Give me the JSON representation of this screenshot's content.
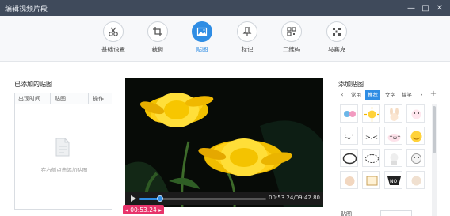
{
  "window": {
    "title": "编辑视频片段",
    "controls": {
      "minimize": "—",
      "maximize": "□",
      "close": "✕"
    }
  },
  "toolbar": {
    "items": [
      {
        "label": "基础设置",
        "icon": "scissors-icon",
        "active": false
      },
      {
        "label": "裁剪",
        "icon": "crop-icon",
        "active": false
      },
      {
        "label": "贴图",
        "icon": "image-icon",
        "active": true
      },
      {
        "label": "标记",
        "icon": "pin-icon",
        "active": false
      },
      {
        "label": "二维码",
        "icon": "qrcode-icon",
        "active": false
      },
      {
        "label": "马赛克",
        "icon": "mosaic-icon",
        "active": false
      }
    ]
  },
  "left_panel": {
    "title": "已添加的贴图",
    "columns": [
      "出现时间",
      "贴图",
      "操作"
    ],
    "empty_text": "在右侧点击添加贴图"
  },
  "player": {
    "time": "00:53.24/09:42.80",
    "progress": 0.16,
    "marker_time": "00:53.24"
  },
  "right_panel": {
    "title": "添加贴图",
    "tabs": [
      "常用",
      "推荐",
      "文字",
      "搞笑"
    ],
    "active_tab": "推荐",
    "add_label": "+"
  },
  "bottom": {
    "label": "贴图"
  },
  "colors": {
    "accent": "#2f8de4",
    "titlebar": "#3f4a5b",
    "marker": "#e8336a"
  }
}
